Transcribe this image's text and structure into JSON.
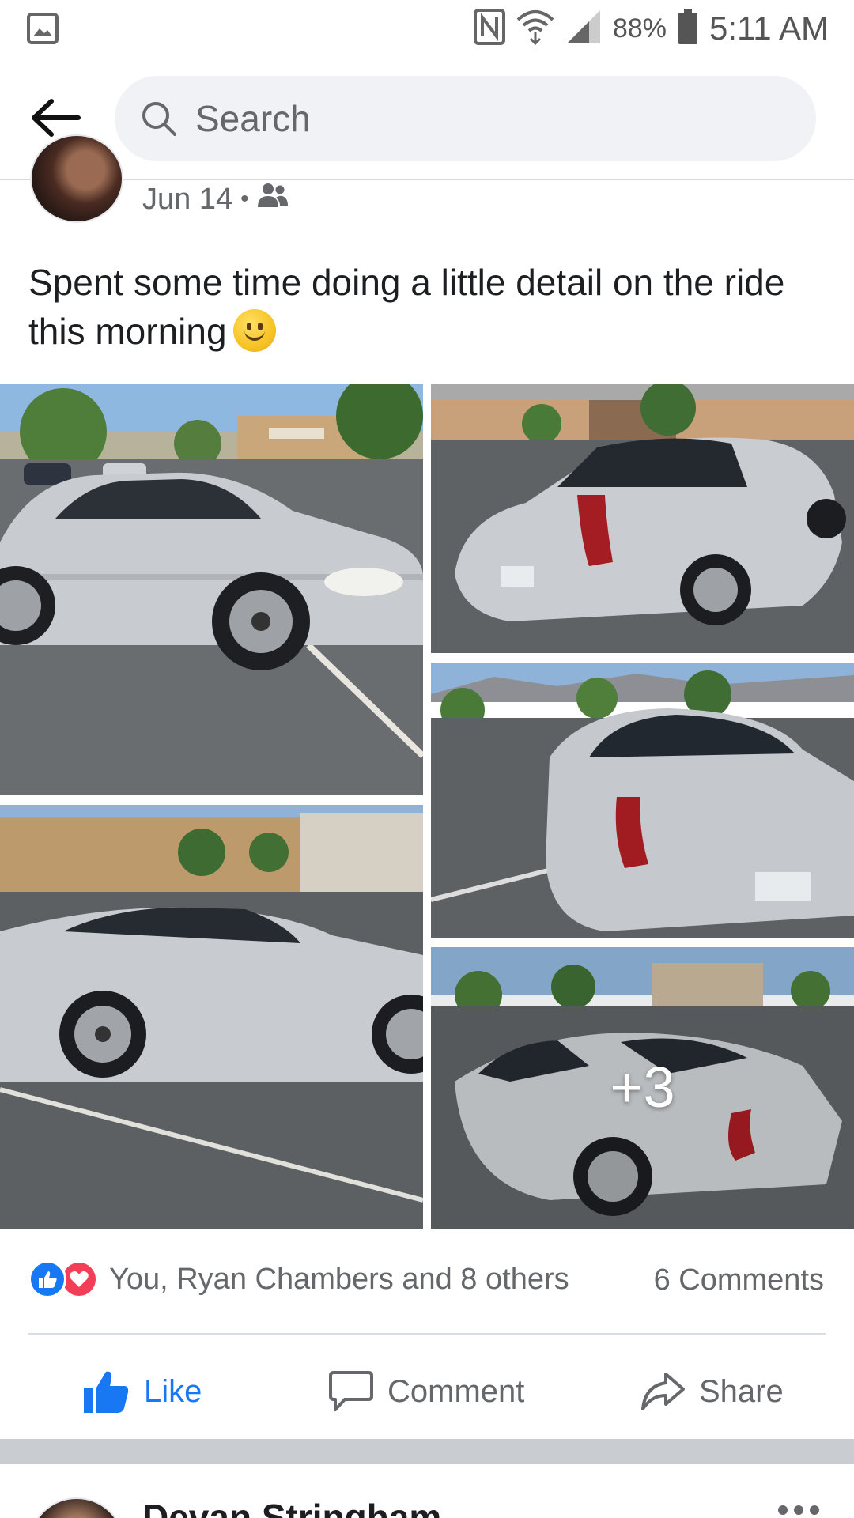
{
  "status_bar": {
    "battery": "88%",
    "time": "5:11 AM",
    "icons": [
      "gallery-icon",
      "nfc-icon",
      "wifi-icon",
      "signal-icon",
      "battery-icon"
    ]
  },
  "header": {
    "search_placeholder": "Search"
  },
  "post": {
    "date": "Jun 14",
    "separator": "•",
    "audience_icon": "friends-icon",
    "text": "Spent some time doing a little detail on the ride this morning",
    "emoji": "slightly-smiling-face",
    "more_photos": "+3",
    "reactions_text": "You, Ryan Chambers and 8 others",
    "comments_text": "6 Comments"
  },
  "actions": {
    "like": "Like",
    "comment": "Comment",
    "share": "Share"
  },
  "next_post": {
    "author": "Devan Stringham"
  },
  "colors": {
    "accent": "#1877f2",
    "love": "#f33e58",
    "muted": "#65676b"
  }
}
